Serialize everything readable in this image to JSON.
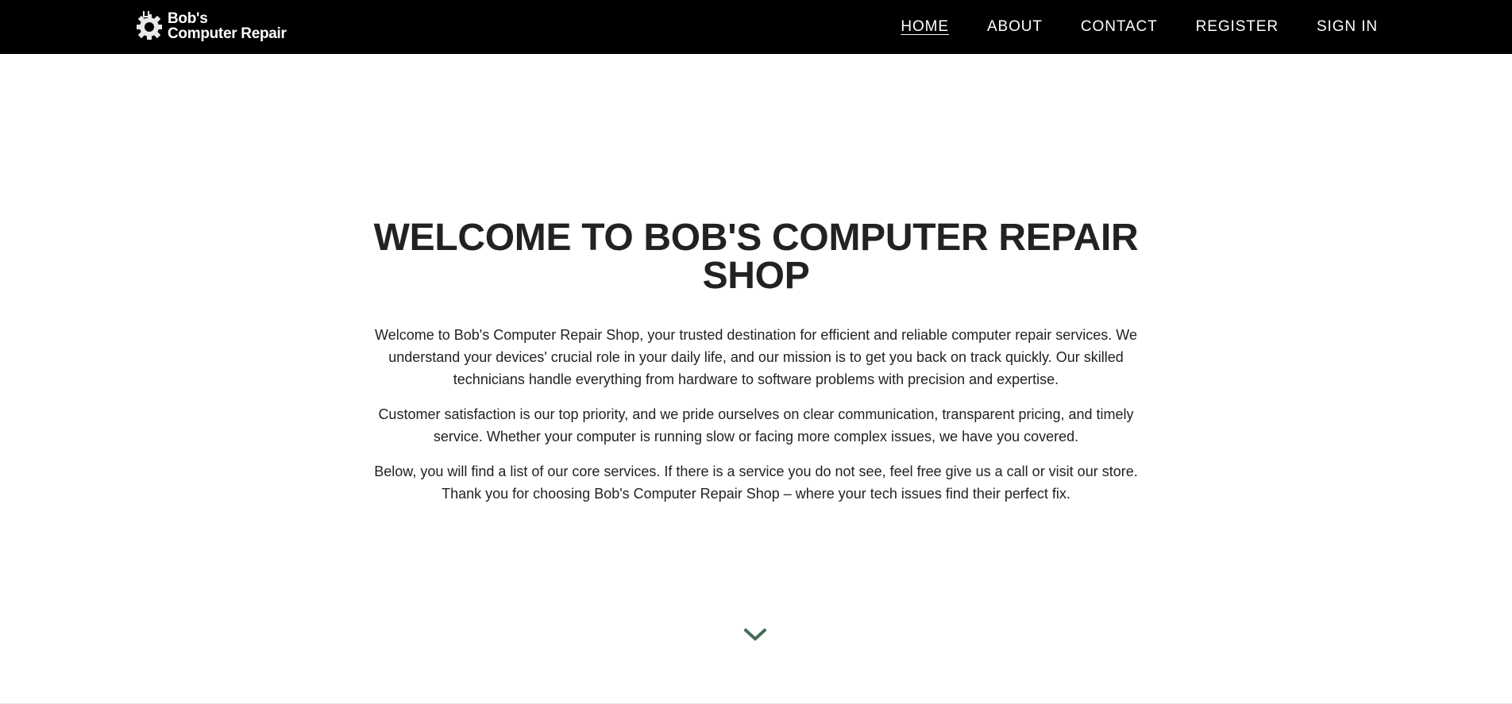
{
  "brand": {
    "name_line1": "Bob's",
    "name_line2": "Computer Repair",
    "icon": "gear-wrench-logo-icon"
  },
  "nav": {
    "items": [
      {
        "label": "HOME",
        "active": true
      },
      {
        "label": "ABOUT",
        "active": false
      },
      {
        "label": "CONTACT",
        "active": false
      },
      {
        "label": "REGISTER",
        "active": false
      },
      {
        "label": "SIGN IN",
        "active": false
      }
    ]
  },
  "hero": {
    "title": "WELCOME TO BOB'S COMPUTER REPAIR SHOP",
    "paragraphs": [
      "Welcome to Bob's Computer Repair Shop, your trusted destination for efficient and reliable computer repair services. We understand your devices' crucial role in your daily life, and our mission is to get you back on track quickly. Our skilled technicians handle everything from hardware to software problems with precision and expertise.",
      "Customer satisfaction is our top priority, and we pride ourselves on clear communication, transparent pricing, and timely service. Whether your computer is running slow or facing more complex issues, we have you covered.",
      "Below, you will find a list of our core services. If there is a service you do not see, feel free give us a call or visit our store. Thank you for choosing Bob's Computer Repair Shop – where your tech issues find their perfect fix."
    ],
    "scroll_icon": "chevron-down-icon"
  },
  "colors": {
    "navbar_bg": "#000000",
    "nav_text": "#ffffff",
    "heading": "#222222",
    "body_text": "#222222",
    "chevron": "#4a6b5a",
    "page_bg": "#ffffff"
  }
}
